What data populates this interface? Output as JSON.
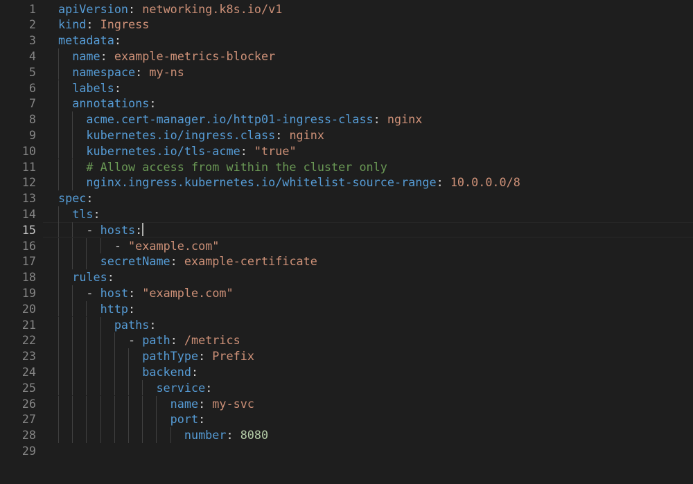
{
  "editor": {
    "language": "yaml",
    "cursor_line": 15,
    "lines": [
      {
        "n": "1",
        "text": "apiVersion: networking.k8s.io/v1"
      },
      {
        "n": "2",
        "text": "kind: Ingress"
      },
      {
        "n": "3",
        "text": "metadata:"
      },
      {
        "n": "4",
        "text": "  name: example-metrics-blocker"
      },
      {
        "n": "5",
        "text": "  namespace: my-ns"
      },
      {
        "n": "6",
        "text": "  labels:"
      },
      {
        "n": "7",
        "text": "  annotations:"
      },
      {
        "n": "8",
        "text": "    acme.cert-manager.io/http01-ingress-class: nginx"
      },
      {
        "n": "9",
        "text": "    kubernetes.io/ingress.class: nginx"
      },
      {
        "n": "10",
        "text": "    kubernetes.io/tls-acme: \"true\""
      },
      {
        "n": "11",
        "text": "    # Allow access from within the cluster only"
      },
      {
        "n": "12",
        "text": "    nginx.ingress.kubernetes.io/whitelist-source-range: 10.0.0.0/8"
      },
      {
        "n": "13",
        "text": "spec:"
      },
      {
        "n": "14",
        "text": "  tls:"
      },
      {
        "n": "15",
        "text": "    - hosts:"
      },
      {
        "n": "16",
        "text": "        - \"example.com\""
      },
      {
        "n": "17",
        "text": "      secretName: example-certificate"
      },
      {
        "n": "18",
        "text": "  rules:"
      },
      {
        "n": "19",
        "text": "    - host: \"example.com\""
      },
      {
        "n": "20",
        "text": "      http:"
      },
      {
        "n": "21",
        "text": "        paths:"
      },
      {
        "n": "22",
        "text": "          - path: /metrics"
      },
      {
        "n": "23",
        "text": "            pathType: Prefix"
      },
      {
        "n": "24",
        "text": "            backend:"
      },
      {
        "n": "25",
        "text": "              service:"
      },
      {
        "n": "26",
        "text": "                name: my-svc"
      },
      {
        "n": "27",
        "text": "                port:"
      },
      {
        "n": "28",
        "text": "                  number: 8080"
      },
      {
        "n": "29",
        "text": ""
      }
    ]
  },
  "colors": {
    "background": "#1e1e1e",
    "key": "#569cd6",
    "string": "#ce9178",
    "number": "#b5cea8",
    "comment": "#6a9955",
    "line_number": "#858585",
    "line_number_active": "#c6c6c6"
  }
}
